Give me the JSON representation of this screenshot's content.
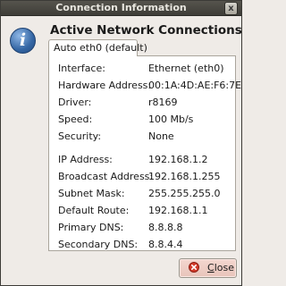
{
  "window": {
    "title": "Connection Information",
    "close_glyph": "x"
  },
  "icon": {
    "name": "info-icon",
    "glyph": "i"
  },
  "heading": "Active Network Connections",
  "tab": {
    "label": "Auto eth0 (default)"
  },
  "general": [
    {
      "label": "Interface:",
      "value": "Ethernet (eth0)"
    },
    {
      "label": "Hardware Address:",
      "value": "00:1A:4D:AE:F6:7E"
    },
    {
      "label": "Driver:",
      "value": "r8169"
    },
    {
      "label": "Speed:",
      "value": "100 Mb/s"
    },
    {
      "label": "Security:",
      "value": "None"
    }
  ],
  "ip": [
    {
      "label": "IP Address:",
      "value": "192.168.1.2"
    },
    {
      "label": "Broadcast Address:",
      "value": "192.168.1.255"
    },
    {
      "label": "Subnet Mask:",
      "value": "255.255.255.0"
    },
    {
      "label": "Default Route:",
      "value": "192.168.1.1"
    },
    {
      "label": "Primary DNS:",
      "value": "8.8.8.8"
    },
    {
      "label": "Secondary DNS:",
      "value": "8.8.4.4"
    }
  ],
  "close_button": {
    "label_first": "C",
    "label_rest": "lose",
    "icon": "close-circle-icon"
  },
  "colors": {
    "titlebar": "#4a4944",
    "window_bg": "#efebe7",
    "panel_bg": "#ffffff",
    "icon_blue": "#3466a4",
    "close_icon_red": "#d23a2a"
  }
}
